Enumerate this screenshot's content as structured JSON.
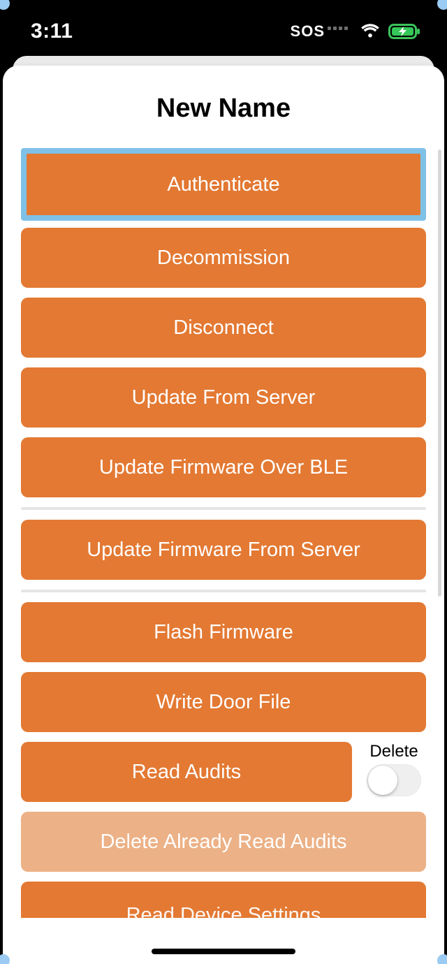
{
  "status": {
    "time": "3:11",
    "sos": "SOS"
  },
  "sheet": {
    "title": "New Name"
  },
  "buttons": {
    "authenticate": "Authenticate",
    "decommission": "Decommission",
    "disconnect": "Disconnect",
    "update_from_server": "Update From Server",
    "update_fw_ble": "Update Firmware Over BLE",
    "update_fw_server": "Update Firmware From Server",
    "flash_firmware": "Flash Firmware",
    "write_door_file": "Write Door File",
    "read_audits": "Read Audits",
    "delete_read_audits": "Delete Already Read Audits",
    "read_device_settings": "Read Device Settings"
  },
  "side": {
    "delete_label": "Delete",
    "delete_on": false
  },
  "colors": {
    "accent": "#e37933",
    "accent_disabled": "#ecb186",
    "highlight": "#7fc0e7",
    "battery": "#34c759"
  }
}
